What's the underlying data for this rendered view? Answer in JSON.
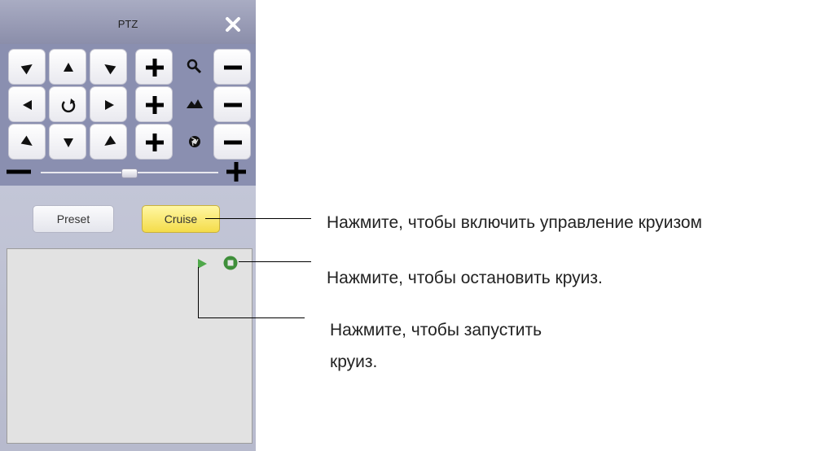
{
  "panel": {
    "title": "PTZ",
    "close_icon": "close-icon",
    "controls": {
      "direction_icons": [
        "arrow-up-left-icon",
        "arrow-up-icon",
        "arrow-up-right-icon",
        "arrow-left-icon",
        "auto-pan-icon",
        "arrow-right-icon",
        "arrow-down-left-icon",
        "arrow-down-icon",
        "arrow-down-right-icon"
      ],
      "lens_icons": [
        "zoom-icon",
        "focus-icon",
        "iris-icon"
      ]
    },
    "speed_slider": {
      "value": 0.5
    },
    "tabs": {
      "preset_label": "Preset",
      "cruise_label": "Cruise",
      "active": "Cruise"
    },
    "cruise_icons": [
      "play-icon",
      "stop-icon"
    ]
  },
  "annotations": {
    "cruise_control": "Нажмите, чтобы включить управление круизом",
    "stop_cruise": "Нажмите, чтобы остановить круиз.",
    "start_cruise_line1": "Нажмите, чтобы запустить",
    "start_cruise_line2": "круиз."
  },
  "colors": {
    "panel_bg": "#8a8fb0",
    "cruise_tab": "#f4dc4a",
    "play_green": "#4fa84a",
    "stop_green": "#3f8f3a"
  }
}
